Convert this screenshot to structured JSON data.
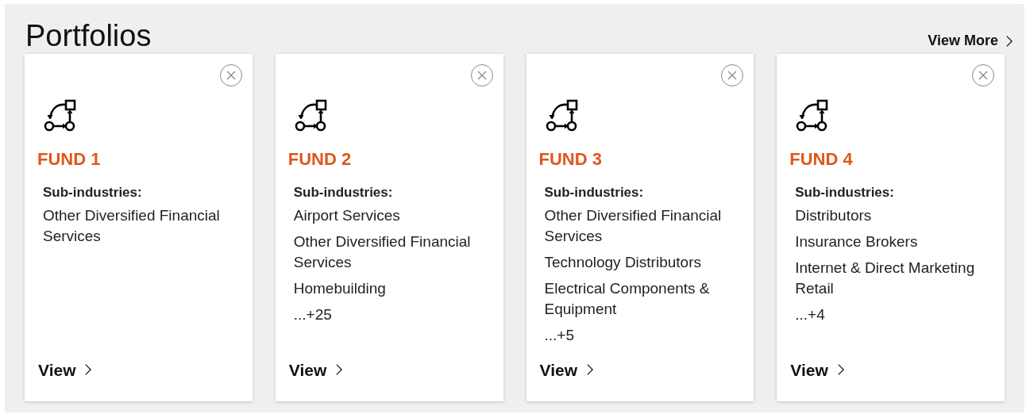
{
  "title": "Portfolios",
  "view_more": "View More",
  "cards": [
    {
      "name": "FUND 1",
      "label": "Sub-industries:",
      "items": [
        "Other Diversified Financial Services"
      ],
      "link": "View"
    },
    {
      "name": "FUND 2",
      "label": "Sub-industries:",
      "items": [
        "Airport Services",
        "Other Diversified Financial Services",
        "Homebuilding",
        "...+25"
      ],
      "link": "View"
    },
    {
      "name": "FUND 3",
      "label": "Sub-industries:",
      "items": [
        "Other Diversified Financial Services",
        "Technology Distributors",
        "Electrical Components & Equipment",
        "...+5"
      ],
      "link": "View"
    },
    {
      "name": "FUND 4",
      "label": "Sub-industries:",
      "items": [
        "Distributors",
        "Insurance Brokers",
        "Internet & Direct Marketing Retail",
        "...+4"
      ],
      "link": "View"
    }
  ]
}
